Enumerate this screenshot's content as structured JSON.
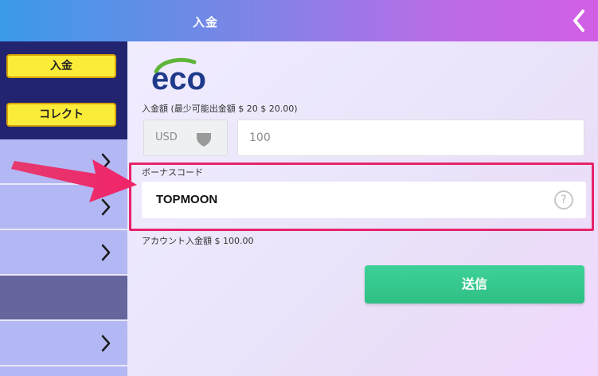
{
  "header": {
    "title": "入金",
    "back_icon": "chevron-left-icon"
  },
  "sidebar": {
    "deposit_label": "入金",
    "collect_label": "コレクト",
    "rows": [
      {
        "icon": "chevron-right-icon",
        "active": false
      },
      {
        "icon": "chevron-right-icon",
        "active": false
      },
      {
        "icon": "chevron-right-icon",
        "active": false
      },
      {
        "icon": "",
        "active": true
      },
      {
        "icon": "chevron-right-icon",
        "active": false
      }
    ]
  },
  "main": {
    "logo_text": "eco",
    "amount_label": "入金額 (最少可能出金額 $ 20  $ 20.00)",
    "currency": "USD",
    "amount_value": "100",
    "bonus_label": "ボーナスコード",
    "bonus_value": "TOPMOON",
    "help_symbol": "?",
    "account_label": "アカウント入金額  $ 100.00",
    "submit_label": "送信"
  },
  "colors": {
    "header_gradient": [
      "#3b9ae8",
      "#d25fe6"
    ],
    "sidebar_dark": "#222470",
    "sidebar_light": "#b3b7f3",
    "button_yellow": "#fcec3a",
    "highlight": "#e6246a",
    "submit_green": "#2fbf84",
    "logo_blue": "#1f3a8a",
    "logo_green": "#5fb53a"
  }
}
